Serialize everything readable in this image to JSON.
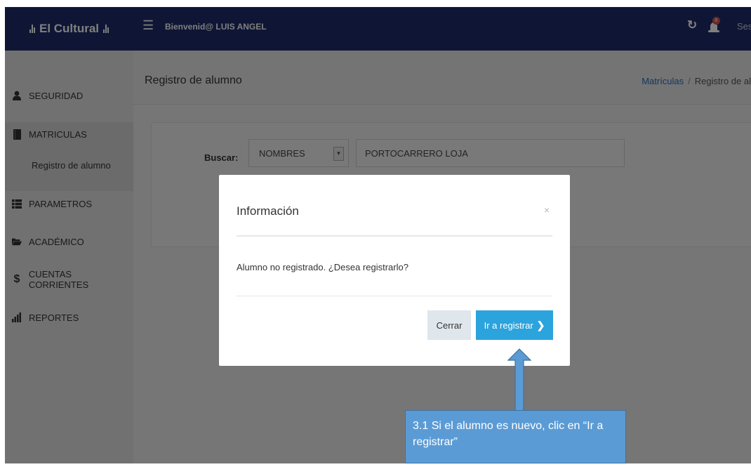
{
  "topbar": {
    "brand": "El Cultural",
    "welcome": "Bienvenid@ LUIS ANGEL",
    "notification_count": "8",
    "session_label": "Ses",
    "color": "#1e2d6b"
  },
  "sidebar": {
    "items": [
      {
        "label": "SEGURIDAD",
        "icon": "user-icon"
      },
      {
        "label": "MATRICULAS",
        "icon": "book-icon"
      },
      {
        "label": "PARAMETROS",
        "icon": "list-icon"
      },
      {
        "label": "ACADÉMICO",
        "icon": "folder-icon"
      },
      {
        "label": "CUENTAS CORRIENTES",
        "icon": "dollar-icon"
      },
      {
        "label": "REPORTES",
        "icon": "bar-chart-icon"
      }
    ],
    "submenu": {
      "label": "Registro de alumno"
    }
  },
  "header": {
    "title": "Registro de alumno",
    "breadcrumb": {
      "link": "Matrículas",
      "separator": "/",
      "current": "Registro de al"
    }
  },
  "search": {
    "label": "Buscar:",
    "select_value": "NOMBRES",
    "input_value": "PORTOCARRERO LOJA"
  },
  "modal": {
    "title": "Información",
    "close": "×",
    "message": "Alumno no registrado. ¿Desea registrarlo?",
    "cancel_label": "Cerrar",
    "confirm_label": "Ir a registrar",
    "confirm_color": "#2ba3dd"
  },
  "callout": {
    "text": "3.1 Si el alumno es nuevo, clic en “Ir a registrar”",
    "color": "#5b9bd5"
  }
}
